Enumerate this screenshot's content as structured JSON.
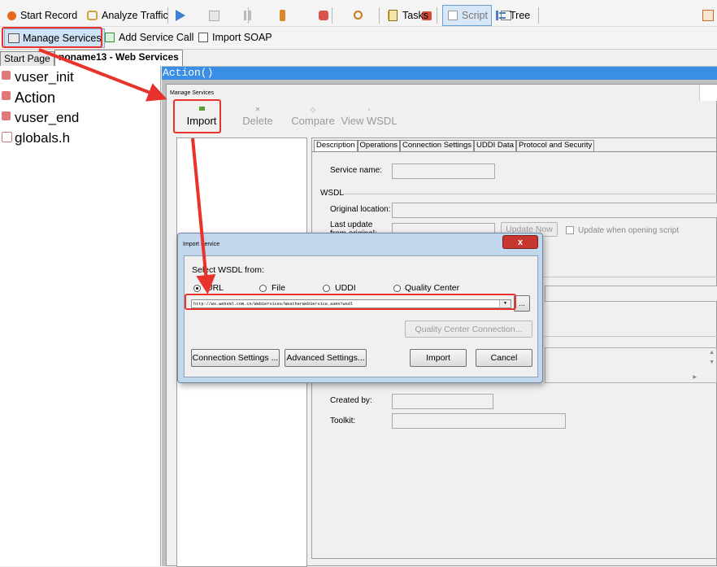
{
  "toolbar1": {
    "start_record": "Start Record",
    "analyze_traffic": "Analyze Traffic",
    "tasks": "Tasks",
    "script": "Script",
    "tree": "Tree"
  },
  "toolbar2": {
    "manage_services": "Manage Services",
    "add_service_call": "Add Service Call",
    "import_soap": "Import SOAP"
  },
  "tabs": {
    "start_page": "Start Page",
    "web_services": "noname13 - Web Services"
  },
  "tree": {
    "items": [
      "vuser_init",
      "Action",
      "vuser_end",
      "globals.h"
    ]
  },
  "editor": {
    "first_line": "Action()"
  },
  "manage_services": {
    "title": "Manage Services",
    "import": "Import",
    "delete": "Delete",
    "compare": "Compare",
    "view_wsdl": "View WSDL",
    "tabs": [
      "Description",
      "Operations",
      "Connection Settings",
      "UDDI Data",
      "Protocol and Security"
    ],
    "service_name_label": "Service name:",
    "wsdl_section": "WSDL",
    "original_location_label": "Original location:",
    "last_update_label_1": "Last update",
    "last_update_label_2": "from original:",
    "update_now": "Update Now",
    "update_when_opening": "Update when opening script",
    "created_by_label": "Created by:",
    "toolkit_label": "Toolkit:"
  },
  "import_service": {
    "title": "Import Service",
    "select_wsdl_from": "Select WSDL from:",
    "options": [
      "URL",
      "File",
      "UDDI",
      "Quality Center"
    ],
    "selected_option": "URL",
    "url_value": "http://ws.webxml.com.cn/WebServices/WeatherWebService.asmx?wsdl",
    "browse": "...",
    "qc_connection": "Quality Center Connection...",
    "connection_settings": "Connection Settings ...",
    "advanced_settings": "Advanced Settings...",
    "import": "Import",
    "cancel": "Cancel",
    "close": "x"
  },
  "colors": {
    "annotation_red": "#e8322b",
    "editor_blue": "#3a8ee6",
    "close_red": "#c7372f"
  }
}
